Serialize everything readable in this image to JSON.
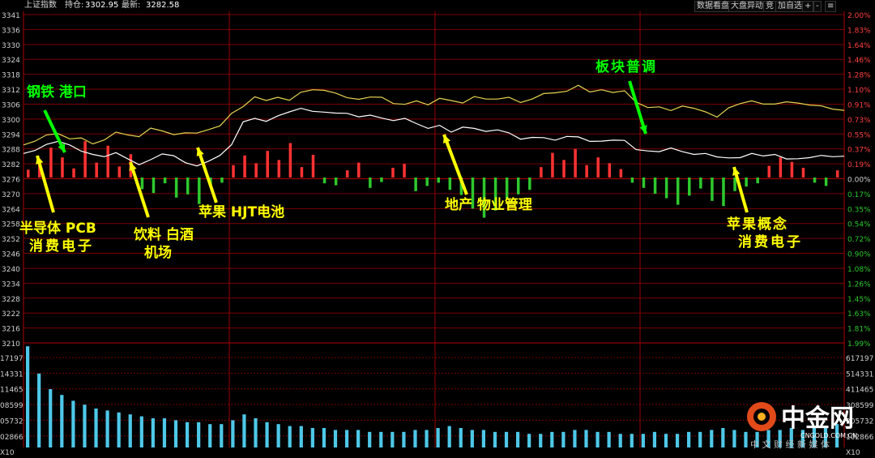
{
  "header": {
    "index_name": "上证指数",
    "prev_close_label": "持仓:",
    "prev_close_value": "3302.95",
    "latest_label": "最新:",
    "latest_value": "3282.58",
    "buttons": [
      "数据看盘",
      "大盘异动",
      "竞",
      "加自选",
      "+",
      "-",
      "≡"
    ]
  },
  "colors": {
    "up": "#ff3232",
    "down": "#2ec82e",
    "white_line": "#ffffff",
    "yellow_line": "#e6d450",
    "grid": "#7a0000",
    "annot_yellow": "#ffff00",
    "annot_green": "#00ff00"
  },
  "chart_data": {
    "type": "line",
    "prev_close": 3276,
    "y_left_ticks": [
      "3341",
      "3336",
      "3330",
      "3324",
      "3318",
      "3312",
      "3306",
      "3300",
      "3294",
      "3288",
      "3282",
      "3276",
      "3270",
      "3264",
      "3258",
      "3252",
      "3246",
      "3240",
      "3234",
      "3228",
      "3222",
      "3216",
      "3210"
    ],
    "y_right_ticks": [
      "2.00%",
      "1.83%",
      "1.64%",
      "1.46%",
      "1.28%",
      "1.10%",
      "0.91%",
      "0.73%",
      "0.55%",
      "0.37%",
      "0.19%",
      "0.00%",
      "0.17%",
      "0.35%",
      "0.54%",
      "0.72%",
      "0.90%",
      "1.08%",
      "1.26%",
      "1.45%",
      "1.63%",
      "1.81%",
      "1.99%"
    ],
    "volume_left_ticks": [
      "17197",
      "14331",
      "11465",
      "08599",
      "05732",
      "02866",
      "X10"
    ],
    "volume_right_ticks": [
      "617197",
      "514331",
      "411465",
      "308599",
      "205732",
      "102866",
      "X10"
    ],
    "series": [
      {
        "name": "",
        "color": "white",
        "values": [
          3285.6,
          3286.8,
          3289.2,
          3290.4,
          3289.0,
          3286.5,
          3285.2,
          3284.3,
          3285.9,
          3283.5,
          3281.1,
          3283.1,
          3285.4,
          3284.7,
          3281.9,
          3280.6,
          3282.5,
          3284.8,
          3289.1,
          3298.2,
          3299.6,
          3298.4,
          3300.6,
          3302.2,
          3303.6,
          3302.4,
          3302.1,
          3301.7,
          3301.6,
          3300.2,
          3300.9,
          3299.7,
          3298.7,
          3299.6,
          3297.5,
          3295.6,
          3296.8,
          3294.1,
          3296.1,
          3295.6,
          3294.4,
          3295.0,
          3293.8,
          3291.3,
          3292.0,
          3291.9,
          3290.9,
          3292.4,
          3292.2,
          3290.4,
          3290.5,
          3290.9,
          3290.8,
          3287.1,
          3286.6,
          3286.3,
          3287.8,
          3286.3,
          3285.2,
          3285.6,
          3284.2,
          3283.8,
          3283.9,
          3285.6,
          3284.6,
          3285.2,
          3283.4,
          3283.5,
          3283.9,
          3284.8,
          3284.3,
          3284.5
        ]
      },
      {
        "name": "",
        "color": "yellow",
        "values": [
          3289.0,
          3290.5,
          3293.0,
          3293.5,
          3291.4,
          3291.8,
          3289.4,
          3291.0,
          3294.1,
          3293.0,
          3292.3,
          3295.7,
          3294.6,
          3293.1,
          3293.8,
          3293.7,
          3295.1,
          3296.6,
          3301.6,
          3304.3,
          3308.2,
          3306.7,
          3308.0,
          3306.8,
          3310.0,
          3311.0,
          3310.8,
          3309.7,
          3307.8,
          3307.2,
          3308.1,
          3308.0,
          3305.5,
          3305.2,
          3306.6,
          3305.0,
          3307.6,
          3306.7,
          3305.7,
          3308.3,
          3307.3,
          3307.3,
          3308.0,
          3305.9,
          3307.3,
          3309.5,
          3309.8,
          3310.4,
          3312.8,
          3310.1,
          3311.0,
          3309.9,
          3310.6,
          3306.0,
          3303.9,
          3304.2,
          3302.7,
          3304.5,
          3303.6,
          3302.2,
          3300.1,
          3303.8,
          3305.5,
          3306.6,
          3305.3,
          3305.3,
          3306.2,
          3305.7,
          3304.9,
          3304.6,
          3303.3,
          3302.8
        ]
      }
    ],
    "bars_up_down": [
      1.2,
      2.8,
      4.6,
      3.1,
      1.4,
      5.6,
      2.3,
      4.9,
      1.7,
      3.6,
      -1.8,
      -2.4,
      -0.9,
      -3.1,
      -2.6,
      -4.1,
      -1.5,
      -0.8,
      1.9,
      3.4,
      2.2,
      4.1,
      2.7,
      5.3,
      1.6,
      3.5,
      -0.9,
      -1.2,
      1.1,
      2.3,
      -1.6,
      -0.7,
      1.5,
      2.1,
      -2.1,
      -1.3,
      -0.8,
      -1.9,
      -2.7,
      -4.8,
      -6.2,
      -5.1,
      -3.3,
      -2.6,
      -1.9,
      1.6,
      3.8,
      2.7,
      4.4,
      1.9,
      3.1,
      2.2,
      1.3,
      -0.8,
      -1.6,
      -2.5,
      -3.2,
      -4.2,
      -2.8,
      -1.7,
      -3.6,
      -4.4,
      -2.1,
      -1.4,
      -0.9,
      1.8,
      3.1,
      2.4,
      1.5,
      -0.8,
      -1.3,
      1.1
    ],
    "volume": [
      52,
      38,
      30,
      27,
      24,
      22,
      20,
      19,
      18,
      17,
      16,
      15,
      15,
      14,
      13,
      13,
      12,
      12,
      14,
      17,
      15,
      13,
      12,
      11,
      11,
      10,
      10,
      9,
      9,
      9,
      8,
      8,
      8,
      8,
      9,
      9,
      10,
      11,
      10,
      9,
      9,
      8,
      8,
      8,
      7,
      7,
      8,
      8,
      9,
      9,
      8,
      8,
      7,
      7,
      7,
      8,
      7,
      7,
      8,
      8,
      9,
      10,
      9,
      8,
      8,
      9,
      9,
      10,
      9,
      10,
      11,
      12
    ]
  },
  "annotations": [
    {
      "text": "钢铁 港口",
      "color": "green"
    },
    {
      "text": "半导体 PCB",
      "color": "yellow"
    },
    {
      "text": "消费电子",
      "color": "yellow"
    },
    {
      "text": "饮料 白酒",
      "color": "yellow"
    },
    {
      "text": "机场",
      "color": "yellow"
    },
    {
      "text": "苹果 HJT电池",
      "color": "yellow"
    },
    {
      "text": "地产 物业管理",
      "color": "yellow"
    },
    {
      "text": "板块普调",
      "color": "green"
    },
    {
      "text": "苹果概念",
      "color": "yellow"
    },
    {
      "text": "消费电子",
      "color": "yellow"
    }
  ],
  "watermark": {
    "brand": "中金网",
    "url": "CNGOLD.COM.CN",
    "tagline": "中 文 财 经 新 媒 体"
  }
}
